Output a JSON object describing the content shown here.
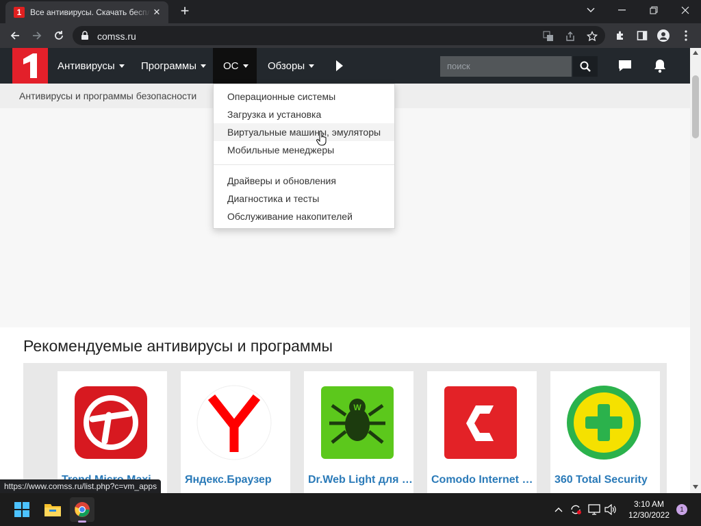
{
  "browser": {
    "tab_title": "Все антивирусы. Скачать бесплатные",
    "tab_favicon": "1",
    "url": "comss.ru"
  },
  "site": {
    "logo": "1",
    "nav": [
      "Антивирусы",
      "Программы",
      "ОС",
      "Обзоры"
    ],
    "search_placeholder": "поиск",
    "breadcrumb": "Антивирусы и программы безопасности",
    "dropdown": {
      "group1": [
        "Операционные системы",
        "Загрузка и установка",
        "Виртуальные машины, эмуляторы",
        "Мобильные менеджеры"
      ],
      "group2": [
        "Драйверы и обновления",
        "Диагностика и тесты",
        "Обслуживание накопителей"
      ]
    },
    "recommended_title": "Рекомендуемые антивирусы и программы",
    "cards": [
      "Trend Micro Maximum Security",
      "Яндекс.Браузер",
      "Dr.Web Light для Android",
      "Comodo Internet Security",
      "360 Total Security"
    ]
  },
  "status_url": "https://www.comss.ru/list.php?c=vm_apps",
  "taskbar": {
    "time": "3:10 AM",
    "date": "12/30/2022",
    "notifications": "1"
  }
}
